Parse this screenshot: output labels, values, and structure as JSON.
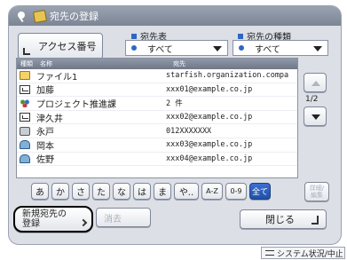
{
  "window": {
    "title": "宛先の登録"
  },
  "access_number": {
    "label": "アクセス番号"
  },
  "filters": {
    "address_book": {
      "label": "宛先表",
      "value": "すべて"
    },
    "type": {
      "label": "宛先の種類",
      "value": "すべて"
    }
  },
  "list": {
    "columns": [
      "種類",
      "名称",
      "宛先"
    ],
    "rows": [
      {
        "icon": "file-icon",
        "name": "ファイル1",
        "address": "starfish.organization.compa"
      },
      {
        "icon": "email-icon",
        "name": "加藤",
        "address": "xxx01@example.co.jp"
      },
      {
        "icon": "group-icon",
        "name": "プロジェクト推進課",
        "address": "2 件"
      },
      {
        "icon": "email-icon",
        "name": "津久井",
        "address": "xxx02@example.co.jp"
      },
      {
        "icon": "fax-icon",
        "name": "永戸",
        "address": "012XXXXXXX"
      },
      {
        "icon": "folder-icon",
        "name": "岡本",
        "address": "xxx03@example.co.jp"
      },
      {
        "icon": "folder-icon",
        "name": "佐野",
        "address": "xxx04@example.co.jp"
      }
    ]
  },
  "pagination": {
    "indicator": "1/2"
  },
  "kana_index": [
    "あ",
    "か",
    "さ",
    "た",
    "な",
    "は",
    "ま",
    "や..",
    "A-Z",
    "0-9",
    "全て"
  ],
  "kana_active": "全て",
  "detail_button": {
    "line1": "詳細/",
    "line2": "編集"
  },
  "new_button": {
    "line1": "新規宛先の",
    "line2": "登録"
  },
  "delete_button": {
    "label": "消去"
  },
  "close_button": {
    "label": "閉じる"
  },
  "status_button": {
    "label": "システム状況/中止"
  }
}
